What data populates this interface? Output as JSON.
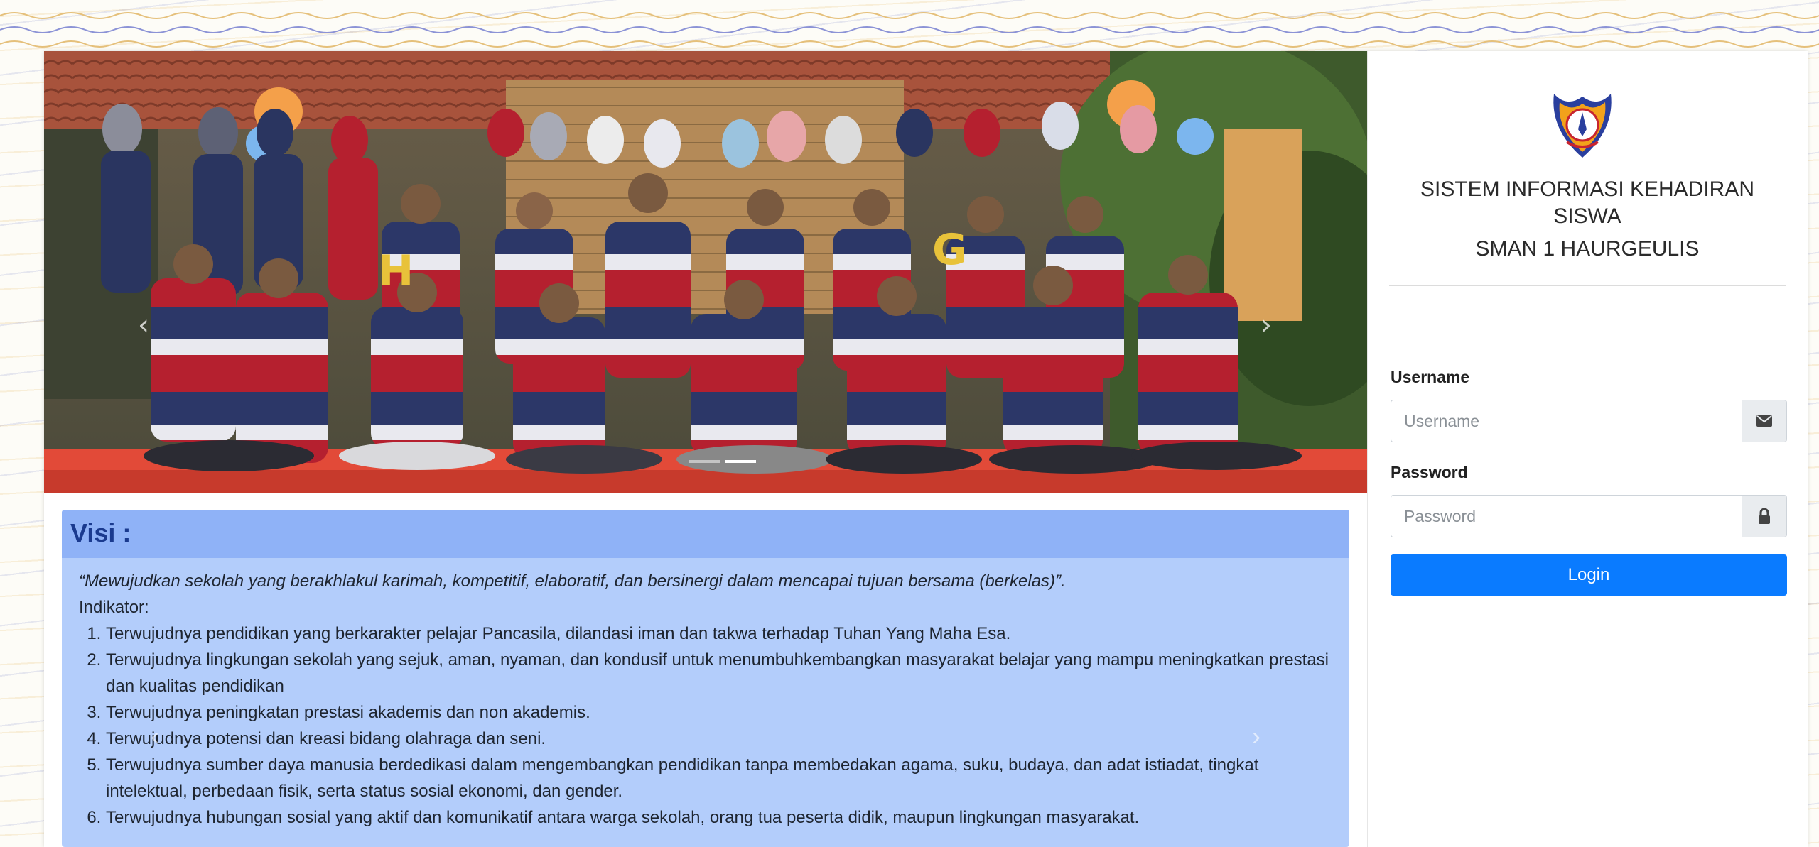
{
  "login": {
    "app_title": "SISTEM INFORMASI KEHADIRAN SISWA",
    "school_name": "SMAN 1 HAURGEULIS",
    "username_label": "Username",
    "username_placeholder": "Username",
    "password_label": "Password",
    "password_placeholder": "Password",
    "login_button": "Login"
  },
  "carousel": {
    "prev_icon": "chevron-left-icon",
    "next_icon": "chevron-right-icon",
    "slide_count": 2,
    "active_slide": 2
  },
  "visi": {
    "title": "Visi :",
    "quote": "“Mewujudkan sekolah yang berakhlakul karimah, kompetitif, elaboratif, dan bersinergi dalam mencapai tujuan bersama (berkelas)”.",
    "indicator_label": "Indikator:",
    "items": [
      "Terwujudnya pendidikan yang berkarakter pelajar Pancasila, dilandasi iman dan takwa terhadap Tuhan Yang Maha Esa.",
      "Terwujudnya lingkungan sekolah yang sejuk, aman, nyaman, dan kondusif untuk menumbuhkembangkan masyarakat belajar yang mampu meningkatkan prestasi dan kualitas pendidikan",
      "Terwujudnya peningkatan prestasi akademis dan non akademis.",
      "Terwujudnya potensi dan kreasi bidang olahraga dan seni.",
      "Terwujudnya sumber daya manusia berdedikasi dalam mengembangkan pendidikan tanpa membedakan agama, suku, budaya, dan adat istiadat, tingkat intelektual, perbedaan fisik, serta status sosial ekonomi, dan gender.",
      "Terwujudnya hubungan sosial yang aktif dan komunikatif antara warga sekolah, orang tua peserta didik, maupun lingkungan masyarakat."
    ]
  },
  "colors": {
    "primary": "#0a7bff",
    "visi_bg": "#b3cdfb",
    "visi_header": "#8fb2f7",
    "shirt_red": "#b5202f",
    "shirt_navy": "#2a3560"
  },
  "icons": {
    "username_addon": "envelope-icon",
    "password_addon": "lock-icon",
    "logo": "school-logo"
  }
}
